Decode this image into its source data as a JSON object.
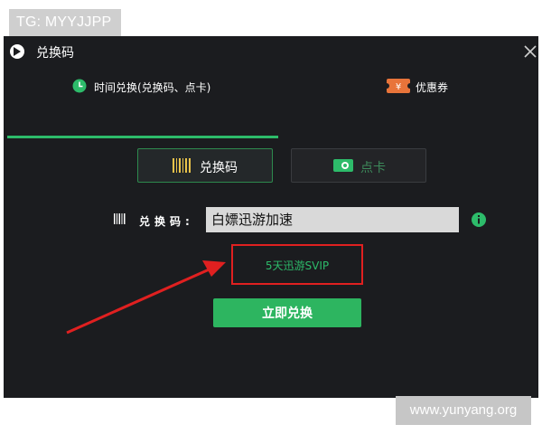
{
  "watermark_top": "TG: MYYJJPP",
  "watermark_bottom": "www.yunyang.org",
  "window": {
    "title": "兑换码",
    "close_symbol": "✕"
  },
  "tabs": [
    {
      "label": "时间兑换(兑换码、点卡)",
      "icon": "clock-icon",
      "active": true
    },
    {
      "label": "优惠券",
      "icon": "coupon-icon",
      "active": false
    }
  ],
  "redeem_type": {
    "options": [
      {
        "label": "兑换码",
        "icon": "barcode-icon",
        "selected": true
      },
      {
        "label": "点卡",
        "icon": "card-icon",
        "selected": false
      }
    ]
  },
  "form": {
    "code_label": "兑换码:",
    "code_value": "白嫖迅游加速",
    "result_text": "5天迅游SVIP",
    "submit_label": "立即兑换"
  },
  "colors": {
    "accent_green": "#2dbb6a",
    "highlight_red": "#e02020",
    "window_bg": "#1b1c1f"
  }
}
